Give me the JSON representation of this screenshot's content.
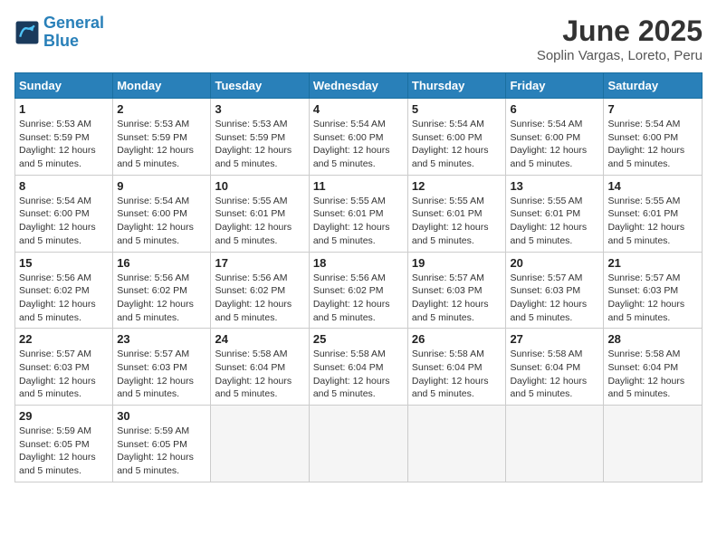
{
  "header": {
    "logo_line1": "General",
    "logo_line2": "Blue",
    "month_title": "June 2025",
    "location": "Soplin Vargas, Loreto, Peru"
  },
  "weekdays": [
    "Sunday",
    "Monday",
    "Tuesday",
    "Wednesday",
    "Thursday",
    "Friday",
    "Saturday"
  ],
  "weeks": [
    [
      {
        "day": "1",
        "sunrise": "5:53 AM",
        "sunset": "5:59 PM",
        "daylight": "12 hours and 5 minutes."
      },
      {
        "day": "2",
        "sunrise": "5:53 AM",
        "sunset": "5:59 PM",
        "daylight": "12 hours and 5 minutes."
      },
      {
        "day": "3",
        "sunrise": "5:53 AM",
        "sunset": "5:59 PM",
        "daylight": "12 hours and 5 minutes."
      },
      {
        "day": "4",
        "sunrise": "5:54 AM",
        "sunset": "6:00 PM",
        "daylight": "12 hours and 5 minutes."
      },
      {
        "day": "5",
        "sunrise": "5:54 AM",
        "sunset": "6:00 PM",
        "daylight": "12 hours and 5 minutes."
      },
      {
        "day": "6",
        "sunrise": "5:54 AM",
        "sunset": "6:00 PM",
        "daylight": "12 hours and 5 minutes."
      },
      {
        "day": "7",
        "sunrise": "5:54 AM",
        "sunset": "6:00 PM",
        "daylight": "12 hours and 5 minutes."
      }
    ],
    [
      {
        "day": "8",
        "sunrise": "5:54 AM",
        "sunset": "6:00 PM",
        "daylight": "12 hours and 5 minutes."
      },
      {
        "day": "9",
        "sunrise": "5:54 AM",
        "sunset": "6:00 PM",
        "daylight": "12 hours and 5 minutes."
      },
      {
        "day": "10",
        "sunrise": "5:55 AM",
        "sunset": "6:01 PM",
        "daylight": "12 hours and 5 minutes."
      },
      {
        "day": "11",
        "sunrise": "5:55 AM",
        "sunset": "6:01 PM",
        "daylight": "12 hours and 5 minutes."
      },
      {
        "day": "12",
        "sunrise": "5:55 AM",
        "sunset": "6:01 PM",
        "daylight": "12 hours and 5 minutes."
      },
      {
        "day": "13",
        "sunrise": "5:55 AM",
        "sunset": "6:01 PM",
        "daylight": "12 hours and 5 minutes."
      },
      {
        "day": "14",
        "sunrise": "5:55 AM",
        "sunset": "6:01 PM",
        "daylight": "12 hours and 5 minutes."
      }
    ],
    [
      {
        "day": "15",
        "sunrise": "5:56 AM",
        "sunset": "6:02 PM",
        "daylight": "12 hours and 5 minutes."
      },
      {
        "day": "16",
        "sunrise": "5:56 AM",
        "sunset": "6:02 PM",
        "daylight": "12 hours and 5 minutes."
      },
      {
        "day": "17",
        "sunrise": "5:56 AM",
        "sunset": "6:02 PM",
        "daylight": "12 hours and 5 minutes."
      },
      {
        "day": "18",
        "sunrise": "5:56 AM",
        "sunset": "6:02 PM",
        "daylight": "12 hours and 5 minutes."
      },
      {
        "day": "19",
        "sunrise": "5:57 AM",
        "sunset": "6:03 PM",
        "daylight": "12 hours and 5 minutes."
      },
      {
        "day": "20",
        "sunrise": "5:57 AM",
        "sunset": "6:03 PM",
        "daylight": "12 hours and 5 minutes."
      },
      {
        "day": "21",
        "sunrise": "5:57 AM",
        "sunset": "6:03 PM",
        "daylight": "12 hours and 5 minutes."
      }
    ],
    [
      {
        "day": "22",
        "sunrise": "5:57 AM",
        "sunset": "6:03 PM",
        "daylight": "12 hours and 5 minutes."
      },
      {
        "day": "23",
        "sunrise": "5:57 AM",
        "sunset": "6:03 PM",
        "daylight": "12 hours and 5 minutes."
      },
      {
        "day": "24",
        "sunrise": "5:58 AM",
        "sunset": "6:04 PM",
        "daylight": "12 hours and 5 minutes."
      },
      {
        "day": "25",
        "sunrise": "5:58 AM",
        "sunset": "6:04 PM",
        "daylight": "12 hours and 5 minutes."
      },
      {
        "day": "26",
        "sunrise": "5:58 AM",
        "sunset": "6:04 PM",
        "daylight": "12 hours and 5 minutes."
      },
      {
        "day": "27",
        "sunrise": "5:58 AM",
        "sunset": "6:04 PM",
        "daylight": "12 hours and 5 minutes."
      },
      {
        "day": "28",
        "sunrise": "5:58 AM",
        "sunset": "6:04 PM",
        "daylight": "12 hours and 5 minutes."
      }
    ],
    [
      {
        "day": "29",
        "sunrise": "5:59 AM",
        "sunset": "6:05 PM",
        "daylight": "12 hours and 5 minutes."
      },
      {
        "day": "30",
        "sunrise": "5:59 AM",
        "sunset": "6:05 PM",
        "daylight": "12 hours and 5 minutes."
      },
      null,
      null,
      null,
      null,
      null
    ]
  ]
}
